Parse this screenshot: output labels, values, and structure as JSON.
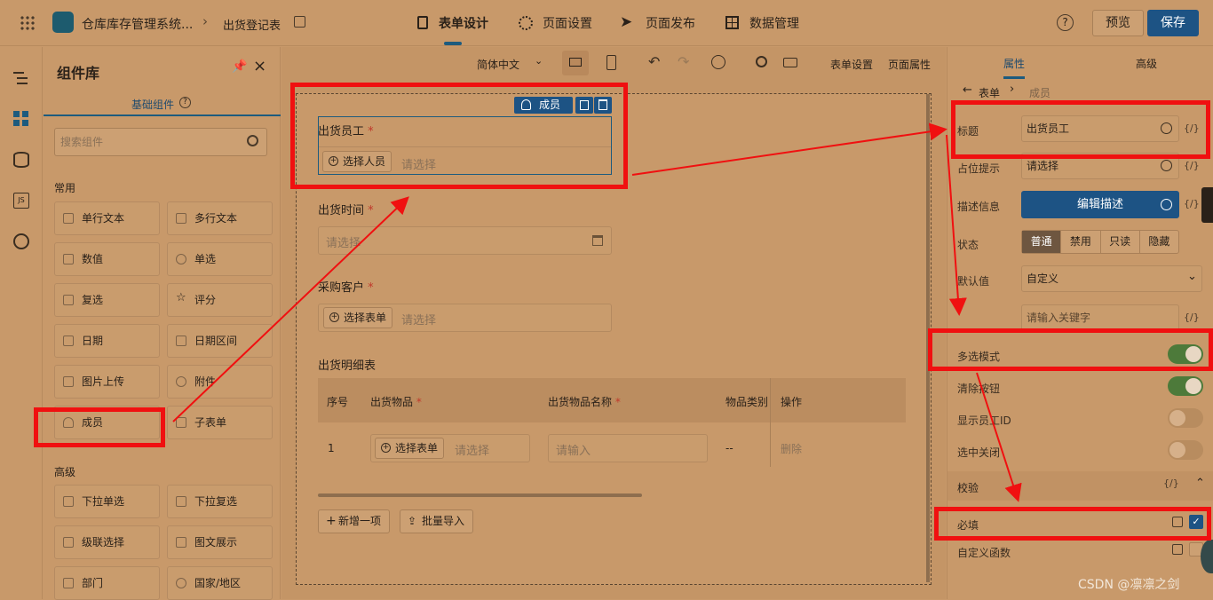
{
  "topbar": {
    "app_name": "仓库库存管理系统...",
    "page_name": "出货登记表",
    "tabs": [
      {
        "label": "表单设计",
        "icon": "form-icon",
        "active": true
      },
      {
        "label": "页面设置",
        "icon": "gear-icon",
        "active": false
      },
      {
        "label": "页面发布",
        "icon": "send-icon",
        "active": false
      },
      {
        "label": "数据管理",
        "icon": "grid-icon",
        "active": false
      }
    ],
    "preview_label": "预览",
    "save_label": "保存"
  },
  "library": {
    "title": "组件库",
    "tab_label": "基础组件",
    "search_placeholder": "搜索组件",
    "section_common": "常用",
    "common_items": [
      {
        "label": "单行文本",
        "icon": "text-input-icon"
      },
      {
        "label": "多行文本",
        "icon": "textarea-icon"
      },
      {
        "label": "数值",
        "icon": "number-icon"
      },
      {
        "label": "单选",
        "icon": "radio-icon"
      },
      {
        "label": "复选",
        "icon": "checkbox-icon"
      },
      {
        "label": "评分",
        "icon": "star-icon"
      },
      {
        "label": "日期",
        "icon": "calendar-icon"
      },
      {
        "label": "日期区间",
        "icon": "date-range-icon"
      },
      {
        "label": "图片上传",
        "icon": "image-icon"
      },
      {
        "label": "附件",
        "icon": "attachment-icon"
      },
      {
        "label": "成员",
        "icon": "user-icon"
      },
      {
        "label": "子表单",
        "icon": "subform-icon"
      }
    ],
    "section_advanced": "高级",
    "advanced_items": [
      {
        "label": "下拉单选",
        "icon": "dropdown-icon"
      },
      {
        "label": "下拉复选",
        "icon": "dropdown-multi-icon"
      },
      {
        "label": "级联选择",
        "icon": "cascader-icon"
      },
      {
        "label": "图文展示",
        "icon": "rich-text-icon"
      },
      {
        "label": "部门",
        "icon": "department-icon"
      },
      {
        "label": "国家/地区",
        "icon": "globe-icon"
      }
    ]
  },
  "toolbar": {
    "language": "简体中文",
    "form_settings": "表单设置",
    "page_props": "页面属性"
  },
  "canvas": {
    "selected_tag": "成员",
    "fields": [
      {
        "label": "出货员工",
        "required": true,
        "button": "选择人员",
        "placeholder": "请选择"
      },
      {
        "label": "出货时间",
        "required": true,
        "placeholder": "请选择"
      },
      {
        "label": "采购客户",
        "required": true,
        "button": "选择表单",
        "placeholder": "请选择"
      }
    ],
    "table": {
      "title": "出货明细表",
      "headers": [
        "序号",
        "出货物品",
        "出货物品名称",
        "物品类别",
        "操作"
      ],
      "header_required": [
        false,
        true,
        true,
        false,
        false
      ],
      "row": {
        "index": "1",
        "select_btn": "选择表单",
        "select_ph": "请选择",
        "input_ph": "请输入",
        "category": "--",
        "action": "删除"
      }
    },
    "add_item": "新增一项",
    "batch_import": "批量导入"
  },
  "props": {
    "tab_props": "属性",
    "tab_advanced": "高级",
    "crumb_form": "表单",
    "crumb_member": "成员",
    "title_label": "标题",
    "title_value": "出货员工",
    "placeholder_label": "占位提示",
    "placeholder_value": "请选择",
    "desc_label": "描述信息",
    "desc_button": "编辑描述",
    "status_label": "状态",
    "status_options": [
      "普通",
      "禁用",
      "只读",
      "隐藏"
    ],
    "default_label": "默认值",
    "default_value": "自定义",
    "keyword_placeholder": "请输入关键字",
    "multi_select": "多选模式",
    "clear_button": "清除按钮",
    "show_employee_id": "显示员工ID",
    "close_on_select": "选中关闭",
    "validation": "校验",
    "required_label": "必填",
    "custom_func": "自定义函数",
    "fx": "{/}",
    "multi_on": true,
    "clear_on": true,
    "showid_on": false,
    "close_on": false
  },
  "watermark": "CSDN @凛凛之剑"
}
